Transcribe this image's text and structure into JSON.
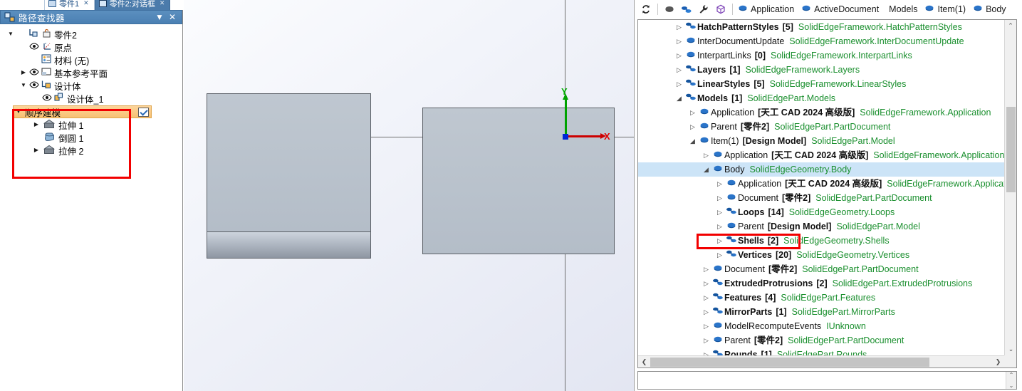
{
  "tabs": [
    {
      "label": "零件1",
      "active": false,
      "icon": "document-icon",
      "close": "✕"
    },
    {
      "label": "零件2:对话框",
      "active": true,
      "icon": "document-icon",
      "close": "✕"
    }
  ],
  "left_panel": {
    "title": "路径查找器",
    "title_icon": "pathfinder-icon",
    "collapse_label": "▼",
    "close_label": "✕",
    "tree": [
      {
        "indent": 0,
        "arrow": "▼",
        "eye": false,
        "icon": "part-icon",
        "label": "零件2",
        "lock": true
      },
      {
        "indent": 1,
        "arrow": "",
        "eye": true,
        "icon": "origin-icon",
        "label": "原点"
      },
      {
        "indent": 1,
        "arrow": "",
        "eye": false,
        "icon": "material-icon",
        "label": "材料 (无)"
      },
      {
        "indent": 1,
        "arrow": "▶",
        "eye": true,
        "icon": "refplane-icon",
        "label": "基本参考平面"
      },
      {
        "indent": 1,
        "arrow": "▼",
        "eye": true,
        "icon": "designbody-icon",
        "label": "设计体"
      },
      {
        "indent": 2,
        "arrow": "",
        "eye": true,
        "icon": "designbody1-icon",
        "label": "设计体_1"
      }
    ],
    "sequence": {
      "arrow": "▼",
      "label": "顺序建模",
      "checkbox_icon": "checked-box-icon",
      "items": [
        {
          "arrow": "▶",
          "icon": "extrude-icon",
          "label": "拉伸 1"
        },
        {
          "arrow": "",
          "icon": "round-icon",
          "label": "倒圆 1"
        },
        {
          "arrow": "▶",
          "icon": "extrude-icon",
          "label": "拉伸 2"
        }
      ]
    },
    "highlight_color": "#f20000"
  },
  "viewport": {
    "axis_x_label": "X",
    "axis_y_label": "Y",
    "axis_x_color": "#cc0000",
    "axis_y_color": "#00a200",
    "origin_color": "#0026d6",
    "body_fill": "#bfc7d0",
    "background": "#e9ecf5"
  },
  "right_panel": {
    "toolbar": {
      "icons": [
        {
          "name": "refresh-icon",
          "glyph": "↻"
        },
        {
          "name": "object-icon",
          "glyph": "⬬"
        },
        {
          "name": "link-icon",
          "glyph": "🔗"
        },
        {
          "name": "wrench-icon",
          "glyph": "🔧"
        },
        {
          "name": "cube-icon",
          "glyph": "⬡"
        }
      ],
      "breadcrumbs": [
        {
          "icon": "object-icon",
          "label": "Application"
        },
        {
          "icon": "object-icon",
          "label": "ActiveDocument"
        },
        {
          "icon": "link-icon",
          "label": "Models"
        },
        {
          "icon": "object-icon",
          "label": "Item(1)"
        },
        {
          "icon": "object-icon",
          "label": "Body"
        }
      ]
    },
    "tree": [
      {
        "indent": 1,
        "arrow": "▷",
        "icon": "collection-icon",
        "name": "HatchPatternStyles",
        "bold": true,
        "count": "[5]",
        "type": "SolidEdgeFramework.HatchPatternStyles"
      },
      {
        "indent": 1,
        "arrow": "▷",
        "icon": "object-icon",
        "name": "InterDocumentUpdate",
        "bold": false,
        "count": "",
        "type": "SolidEdgeFramework.InterDocumentUpdate"
      },
      {
        "indent": 1,
        "arrow": "▷",
        "icon": "object-icon",
        "name": "InterpartLinks",
        "bold": false,
        "count": "[0]",
        "type": "SolidEdgeFramework.InterpartLinks"
      },
      {
        "indent": 1,
        "arrow": "▷",
        "icon": "collection-icon",
        "name": "Layers",
        "bold": true,
        "count": "[1]",
        "type": "SolidEdgeFramework.Layers"
      },
      {
        "indent": 1,
        "arrow": "▷",
        "icon": "collection-icon",
        "name": "LinearStyles",
        "bold": true,
        "count": "[5]",
        "type": "SolidEdgeFramework.LinearStyles"
      },
      {
        "indent": 1,
        "arrow": "◢",
        "icon": "collection-icon",
        "name": "Models",
        "bold": true,
        "count": "[1]",
        "type": "SolidEdgePart.Models"
      },
      {
        "indent": 2,
        "arrow": "▷",
        "icon": "object-icon",
        "name": "Application",
        "bold": false,
        "count": "[天工 CAD 2024 高级版]",
        "type": "SolidEdgeFramework.Application"
      },
      {
        "indent": 2,
        "arrow": "▷",
        "icon": "object-icon",
        "name": "Parent",
        "bold": false,
        "count": "[零件2]",
        "type": "SolidEdgePart.PartDocument"
      },
      {
        "indent": 2,
        "arrow": "◢",
        "icon": "object-icon",
        "name": "Item(1)",
        "bold": false,
        "count": "[Design Model]",
        "type": "SolidEdgePart.Model"
      },
      {
        "indent": 3,
        "arrow": "▷",
        "icon": "object-icon",
        "name": "Application",
        "bold": false,
        "count": "[天工 CAD 2024 高级版]",
        "type": "SolidEdgeFramework.Application"
      },
      {
        "indent": 3,
        "arrow": "◢",
        "icon": "object-icon",
        "name": "Body",
        "bold": false,
        "count": "",
        "type": "SolidEdgeGeometry.Body",
        "selected": true
      },
      {
        "indent": 4,
        "arrow": "▷",
        "icon": "object-icon",
        "name": "Application",
        "bold": false,
        "count": "[天工 CAD 2024 高级版]",
        "type": "SolidEdgeFramework.Applicatio"
      },
      {
        "indent": 4,
        "arrow": "▷",
        "icon": "object-icon",
        "name": "Document",
        "bold": false,
        "count": "[零件2]",
        "type": "SolidEdgePart.PartDocument"
      },
      {
        "indent": 4,
        "arrow": "▷",
        "icon": "collection-icon",
        "name": "Loops",
        "bold": true,
        "count": "[14]",
        "type": "SolidEdgeGeometry.Loops"
      },
      {
        "indent": 4,
        "arrow": "▷",
        "icon": "object-icon",
        "name": "Parent",
        "bold": false,
        "count": "[Design Model]",
        "type": "SolidEdgePart.Model"
      },
      {
        "indent": 4,
        "arrow": "▷",
        "icon": "collection-icon",
        "name": "Shells",
        "bold": true,
        "count": "[2]",
        "type": "SolidEdgeGeometry.Shells",
        "highlighted": true
      },
      {
        "indent": 4,
        "arrow": "▷",
        "icon": "collection-icon",
        "name": "Vertices",
        "bold": true,
        "count": "[20]",
        "type": "SolidEdgeGeometry.Vertices"
      },
      {
        "indent": 3,
        "arrow": "▷",
        "icon": "object-icon",
        "name": "Document",
        "bold": false,
        "count": "[零件2]",
        "type": "SolidEdgePart.PartDocument"
      },
      {
        "indent": 3,
        "arrow": "▷",
        "icon": "collection-icon",
        "name": "ExtrudedProtrusions",
        "bold": true,
        "count": "[2]",
        "type": "SolidEdgePart.ExtrudedProtrusions"
      },
      {
        "indent": 3,
        "arrow": "▷",
        "icon": "collection-icon",
        "name": "Features",
        "bold": true,
        "count": "[4]",
        "type": "SolidEdgePart.Features"
      },
      {
        "indent": 3,
        "arrow": "▷",
        "icon": "collection-icon",
        "name": "MirrorParts",
        "bold": true,
        "count": "[1]",
        "type": "SolidEdgePart.MirrorParts"
      },
      {
        "indent": 3,
        "arrow": "▷",
        "icon": "object-icon",
        "name": "ModelRecomputeEvents",
        "bold": false,
        "count": "",
        "type": "IUnknown"
      },
      {
        "indent": 3,
        "arrow": "▷",
        "icon": "object-icon",
        "name": "Parent",
        "bold": false,
        "count": "[零件2]",
        "type": "SolidEdgePart.PartDocument"
      },
      {
        "indent": 3,
        "arrow": "▷",
        "icon": "collection-icon",
        "name": "Rounds",
        "bold": true,
        "count": "[1]",
        "type": "SolidEdgePart.Rounds"
      }
    ],
    "scrollbars": {
      "v_up": "⌃",
      "v_down": "⌄",
      "h_left": "❮",
      "h_right": "❯"
    },
    "highlight_color": "#f20000"
  }
}
